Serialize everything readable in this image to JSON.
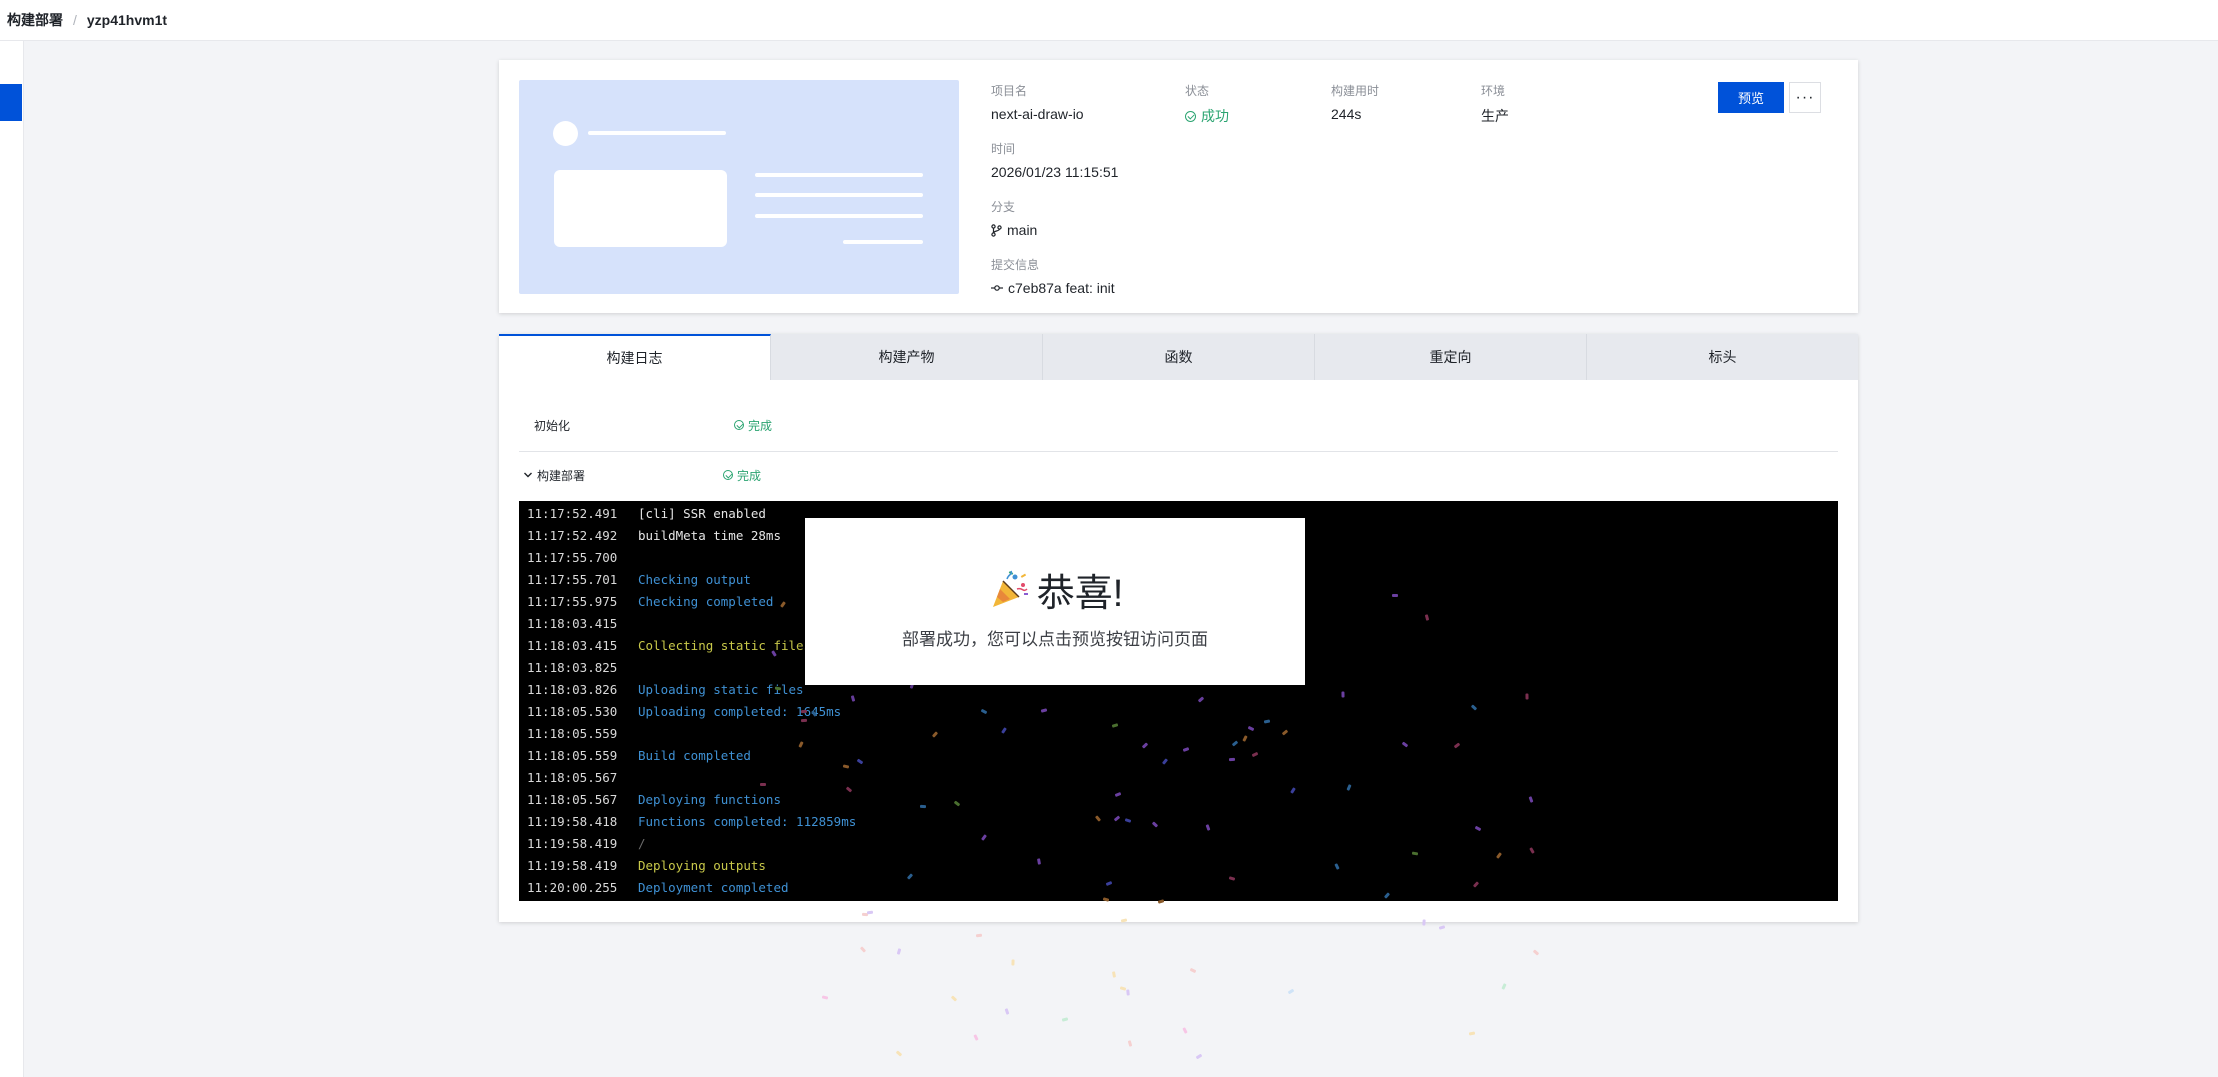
{
  "breadcrumb": {
    "root": "构建部署",
    "separator": "/",
    "current": "yzp41hvm1t"
  },
  "deployment": {
    "fields": {
      "project": {
        "label": "项目名",
        "value": "next-ai-draw-io"
      },
      "status": {
        "label": "状态",
        "value": "成功"
      },
      "duration": {
        "label": "构建用时",
        "value": "244s"
      },
      "environment": {
        "label": "环境",
        "value": "生产"
      },
      "time": {
        "label": "时间",
        "value": "2026/01/23 11:15:51"
      },
      "branch": {
        "label": "分支",
        "value": "main"
      },
      "commit": {
        "label": "提交信息",
        "value": "c7eb87a feat: init"
      }
    },
    "preview_label": "预览",
    "more_label": "···"
  },
  "tabs": [
    "构建日志",
    "构建产物",
    "函数",
    "重定向",
    "标头"
  ],
  "stages": [
    {
      "name": "初始化",
      "status": "完成"
    },
    {
      "name": "构建部署",
      "status": "完成"
    }
  ],
  "log": [
    {
      "ts": "11:17:52.491",
      "msg": "[cli] SSR enabled",
      "color": "white"
    },
    {
      "ts": "11:17:52.492",
      "msg": "buildMeta time 28ms",
      "color": "white"
    },
    {
      "ts": "11:17:55.700",
      "msg": "",
      "color": "white"
    },
    {
      "ts": "11:17:55.701",
      "msg": "Checking output",
      "color": "blue"
    },
    {
      "ts": "11:17:55.975",
      "msg": "Checking completed",
      "color": "blue"
    },
    {
      "ts": "11:18:03.415",
      "msg": "",
      "color": "white"
    },
    {
      "ts": "11:18:03.415",
      "msg": "Collecting static files",
      "color": "yellow"
    },
    {
      "ts": "11:18:03.825",
      "msg": "",
      "color": "white"
    },
    {
      "ts": "11:18:03.826",
      "msg": "Uploading static files",
      "color": "blue"
    },
    {
      "ts": "11:18:05.530",
      "msg": "Uploading completed: 1645ms",
      "color": "blue"
    },
    {
      "ts": "11:18:05.559",
      "msg": "",
      "color": "white"
    },
    {
      "ts": "11:18:05.559",
      "msg": "Build completed",
      "color": "blue"
    },
    {
      "ts": "11:18:05.567",
      "msg": "",
      "color": "white"
    },
    {
      "ts": "11:18:05.567",
      "msg": "Deploying functions",
      "color": "blue"
    },
    {
      "ts": "11:19:58.418",
      "msg": "Functions completed: 112859ms",
      "color": "blue"
    },
    {
      "ts": "11:19:58.419",
      "msg": "/",
      "color": "gray"
    },
    {
      "ts": "11:19:58.419",
      "msg": "Deploying outputs",
      "color": "yellow"
    },
    {
      "ts": "11:20:00.255",
      "msg": "Deployment completed",
      "color": "blue"
    }
  ],
  "modal": {
    "icon": "party-popper-icon",
    "title": "恭喜!",
    "message": "部署成功，您可以点击预览按钮访问页面"
  },
  "colors": {
    "primary": "#0052d9",
    "success": "#2ba471"
  }
}
